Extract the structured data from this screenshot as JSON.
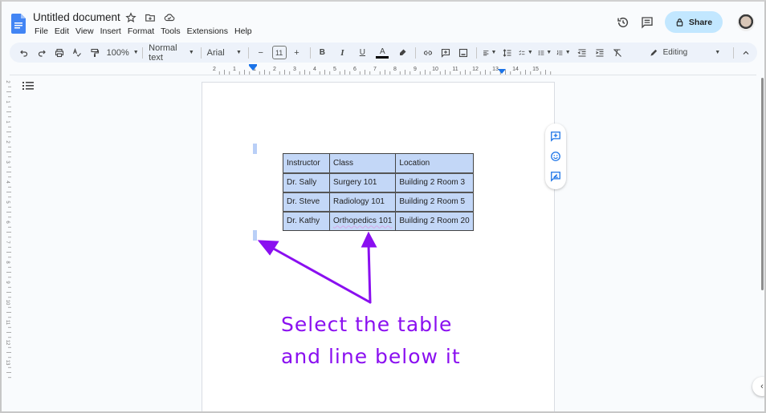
{
  "app": {
    "doc_title": "Untitled document",
    "title_icons": [
      "star-icon",
      "move-to-folder-icon",
      "cloud-saved-icon"
    ],
    "menu": [
      "File",
      "Edit",
      "View",
      "Insert",
      "Format",
      "Tools",
      "Extensions",
      "Help"
    ],
    "share_label": "Share",
    "accent_color": "#1a73e8",
    "share_bg": "#c2e7ff"
  },
  "toolbar": {
    "zoom": "100%",
    "style": "Normal text",
    "font": "Arial",
    "font_size": "11",
    "mode": "Editing",
    "bold": "B",
    "italic": "I",
    "underline": "U",
    "text_color": "A"
  },
  "ruler": {
    "ticks": [
      "2",
      "1",
      "1",
      "2",
      "3",
      "4",
      "5",
      "6",
      "7",
      "8",
      "9",
      "10",
      "11",
      "12",
      "13",
      "14",
      "15"
    ]
  },
  "vruler": {
    "ticks": [
      "2",
      "1",
      "1",
      "2",
      "3",
      "4",
      "5",
      "6",
      "7",
      "8",
      "9",
      "10",
      "11",
      "12",
      "13"
    ]
  },
  "table": {
    "headers": [
      "Instructor",
      "Class",
      "Location"
    ],
    "rows": [
      [
        "Dr. Sally",
        "Surgery 101",
        "Building 2 Room 3"
      ],
      [
        "Dr. Steve",
        "Radiology 101",
        "Building 2 Room 5"
      ],
      [
        "Dr. Kathy",
        "Orthopedics 101",
        "Building 2 Room 20"
      ]
    ],
    "selection_color": "#c3d7f7"
  },
  "annotation": {
    "line1": "Select the table",
    "line2": "and line below it",
    "color": "#8a0ff0"
  },
  "side_actions": [
    "add-comment-icon",
    "emoji-reaction-icon",
    "suggest-edits-icon"
  ]
}
